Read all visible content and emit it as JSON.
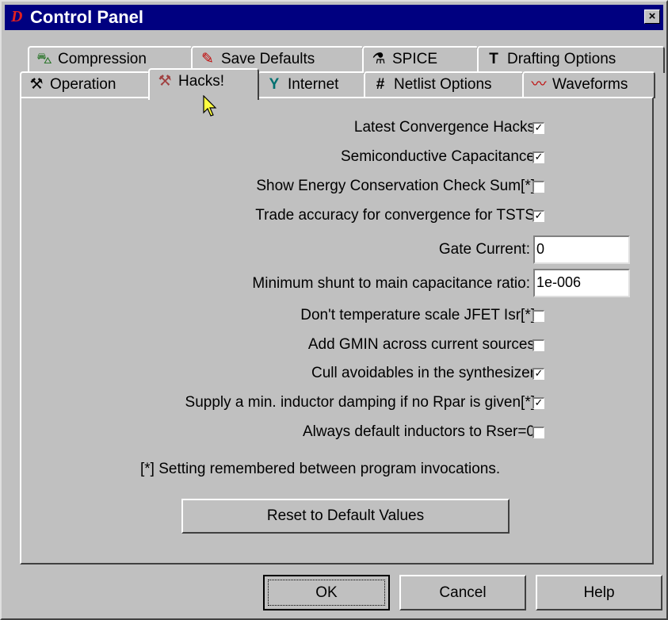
{
  "window": {
    "title": "Control Panel",
    "close_glyph": "×",
    "app_icon_glyph": "D"
  },
  "tabs": {
    "row1": [
      {
        "label": "Compression",
        "icon": "compression-icon",
        "glyph": "⛍"
      },
      {
        "label": "Save Defaults",
        "icon": "pen-icon",
        "glyph": "✎"
      },
      {
        "label": "SPICE",
        "icon": "spice-icon",
        "glyph": "⚗"
      },
      {
        "label": "Drafting Options",
        "icon": "t-square-icon",
        "glyph": "T"
      }
    ],
    "row2": [
      {
        "label": "Operation",
        "icon": "factory-icon",
        "glyph": "⚒"
      },
      {
        "label": "Hacks!",
        "icon": "hammer-icon",
        "glyph": "⚒",
        "selected": true
      },
      {
        "label": "Internet",
        "icon": "internet-icon",
        "glyph": "Y"
      },
      {
        "label": "Netlist Options",
        "icon": "grid-icon",
        "glyph": "#"
      },
      {
        "label": "Waveforms",
        "icon": "waveform-icon",
        "glyph": "〰"
      }
    ]
  },
  "options": [
    {
      "label": "Latest Convergence Hacks",
      "checked": true
    },
    {
      "label": "Semiconductive Capacitance",
      "checked": true
    },
    {
      "label": "Show Energy Conservation Check Sum[*]",
      "checked": false
    },
    {
      "label": "Trade accuracy for convergence for TSTS",
      "checked": true
    }
  ],
  "fields": {
    "gate_current": {
      "label": "Gate Current:",
      "value": "0"
    },
    "min_shunt": {
      "label": "Minimum shunt to main capacitance ratio:",
      "value": "1e-006"
    }
  },
  "options2": [
    {
      "label": "Don't temperature scale JFET Isr[*]",
      "checked": false
    },
    {
      "label": "Add GMIN across current sources",
      "checked": false
    },
    {
      "label": "Cull avoidables in the synthesizer",
      "checked": true
    },
    {
      "label": "Supply a min. inductor damping if no Rpar is given[*]",
      "checked": true
    },
    {
      "label": "Always default inductors to Rser=0",
      "checked": false
    }
  ],
  "footnote": "[*] Setting remembered between program invocations.",
  "reset_label": "Reset to Default Values",
  "buttons": {
    "ok": "OK",
    "cancel": "Cancel",
    "help": "Help"
  },
  "check_glyph": "✓"
}
